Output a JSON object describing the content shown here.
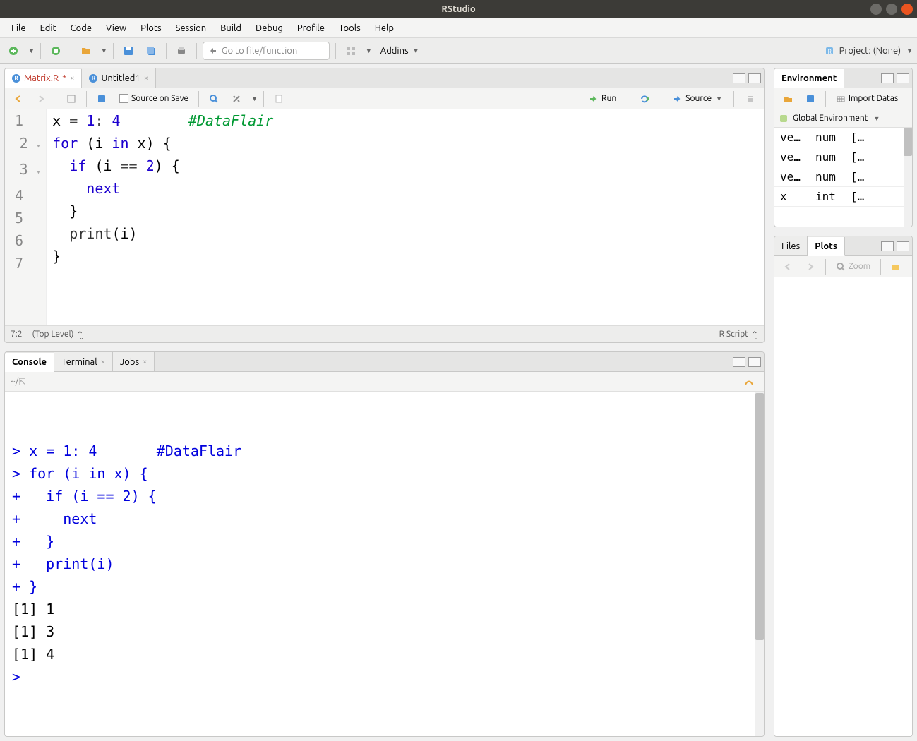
{
  "window": {
    "title": "RStudio"
  },
  "menu": [
    "File",
    "Edit",
    "Code",
    "View",
    "Plots",
    "Session",
    "Build",
    "Debug",
    "Profile",
    "Tools",
    "Help"
  ],
  "toolbar": {
    "goto_placeholder": "Go to file/function",
    "addins_label": "Addins",
    "project_label": "Project: (None)"
  },
  "editor": {
    "tabs": [
      {
        "label": "Matrix.R",
        "dirty": true
      },
      {
        "label": "Untitled1",
        "dirty": false
      }
    ],
    "toolbar": {
      "source_on_save": "Source on Save",
      "run": "Run",
      "source": "Source"
    },
    "lines": [
      {
        "n": 1,
        "fold": "",
        "html": "x <span class='tok-op'>=</span> <span class='tok-num'>1</span><span class='tok-op'>:</span> <span class='tok-num'>4</span>        <span class='tok-comment'>#DataFlair</span>"
      },
      {
        "n": 2,
        "fold": "▾",
        "html": "<span class='tok-kw'>for</span> (i <span class='tok-kw'>in</span> x) {"
      },
      {
        "n": 3,
        "fold": "▾",
        "html": "  <span class='tok-kw'>if</span> (i <span class='tok-op'>==</span> <span class='tok-num'>2</span>) {"
      },
      {
        "n": 4,
        "fold": "",
        "html": "    <span class='tok-kw'>next</span>"
      },
      {
        "n": 5,
        "fold": "",
        "html": "  }"
      },
      {
        "n": 6,
        "fold": "",
        "html": "  <span class='tok-fn'>print</span>(i)"
      },
      {
        "n": 7,
        "fold": "",
        "html": "}"
      }
    ],
    "status": {
      "pos": "7:2",
      "scope": "(Top Level)",
      "type": "R Script"
    }
  },
  "console": {
    "tabs": [
      "Console",
      "Terminal",
      "Jobs"
    ],
    "cwd": "~/",
    "lines": [
      {
        "cls": "blue",
        "text": "> x = 1: 4       #DataFlair"
      },
      {
        "cls": "blue",
        "text": "> for (i in x) {"
      },
      {
        "cls": "blue",
        "text": "+   if (i == 2) {"
      },
      {
        "cls": "blue",
        "text": "+     next"
      },
      {
        "cls": "blue",
        "text": "+   }"
      },
      {
        "cls": "blue",
        "text": "+   print(i)"
      },
      {
        "cls": "blue",
        "text": "+ }"
      },
      {
        "cls": "",
        "text": "[1] 1"
      },
      {
        "cls": "",
        "text": "[1] 3"
      },
      {
        "cls": "",
        "text": "[1] 4"
      },
      {
        "cls": "blue",
        "text": "> "
      }
    ]
  },
  "environment": {
    "tab": "Environment",
    "import": "Import Datas",
    "scope": "Global Environment",
    "rows": [
      {
        "name": "ve…",
        "type": "num",
        "val": "[…"
      },
      {
        "name": "ve…",
        "type": "num",
        "val": "[…"
      },
      {
        "name": "ve…",
        "type": "num",
        "val": "[…"
      },
      {
        "name": "x",
        "type": "int",
        "val": "[…"
      }
    ]
  },
  "plots": {
    "tabs": [
      "Files",
      "Plots"
    ],
    "zoom": "Zoom"
  }
}
